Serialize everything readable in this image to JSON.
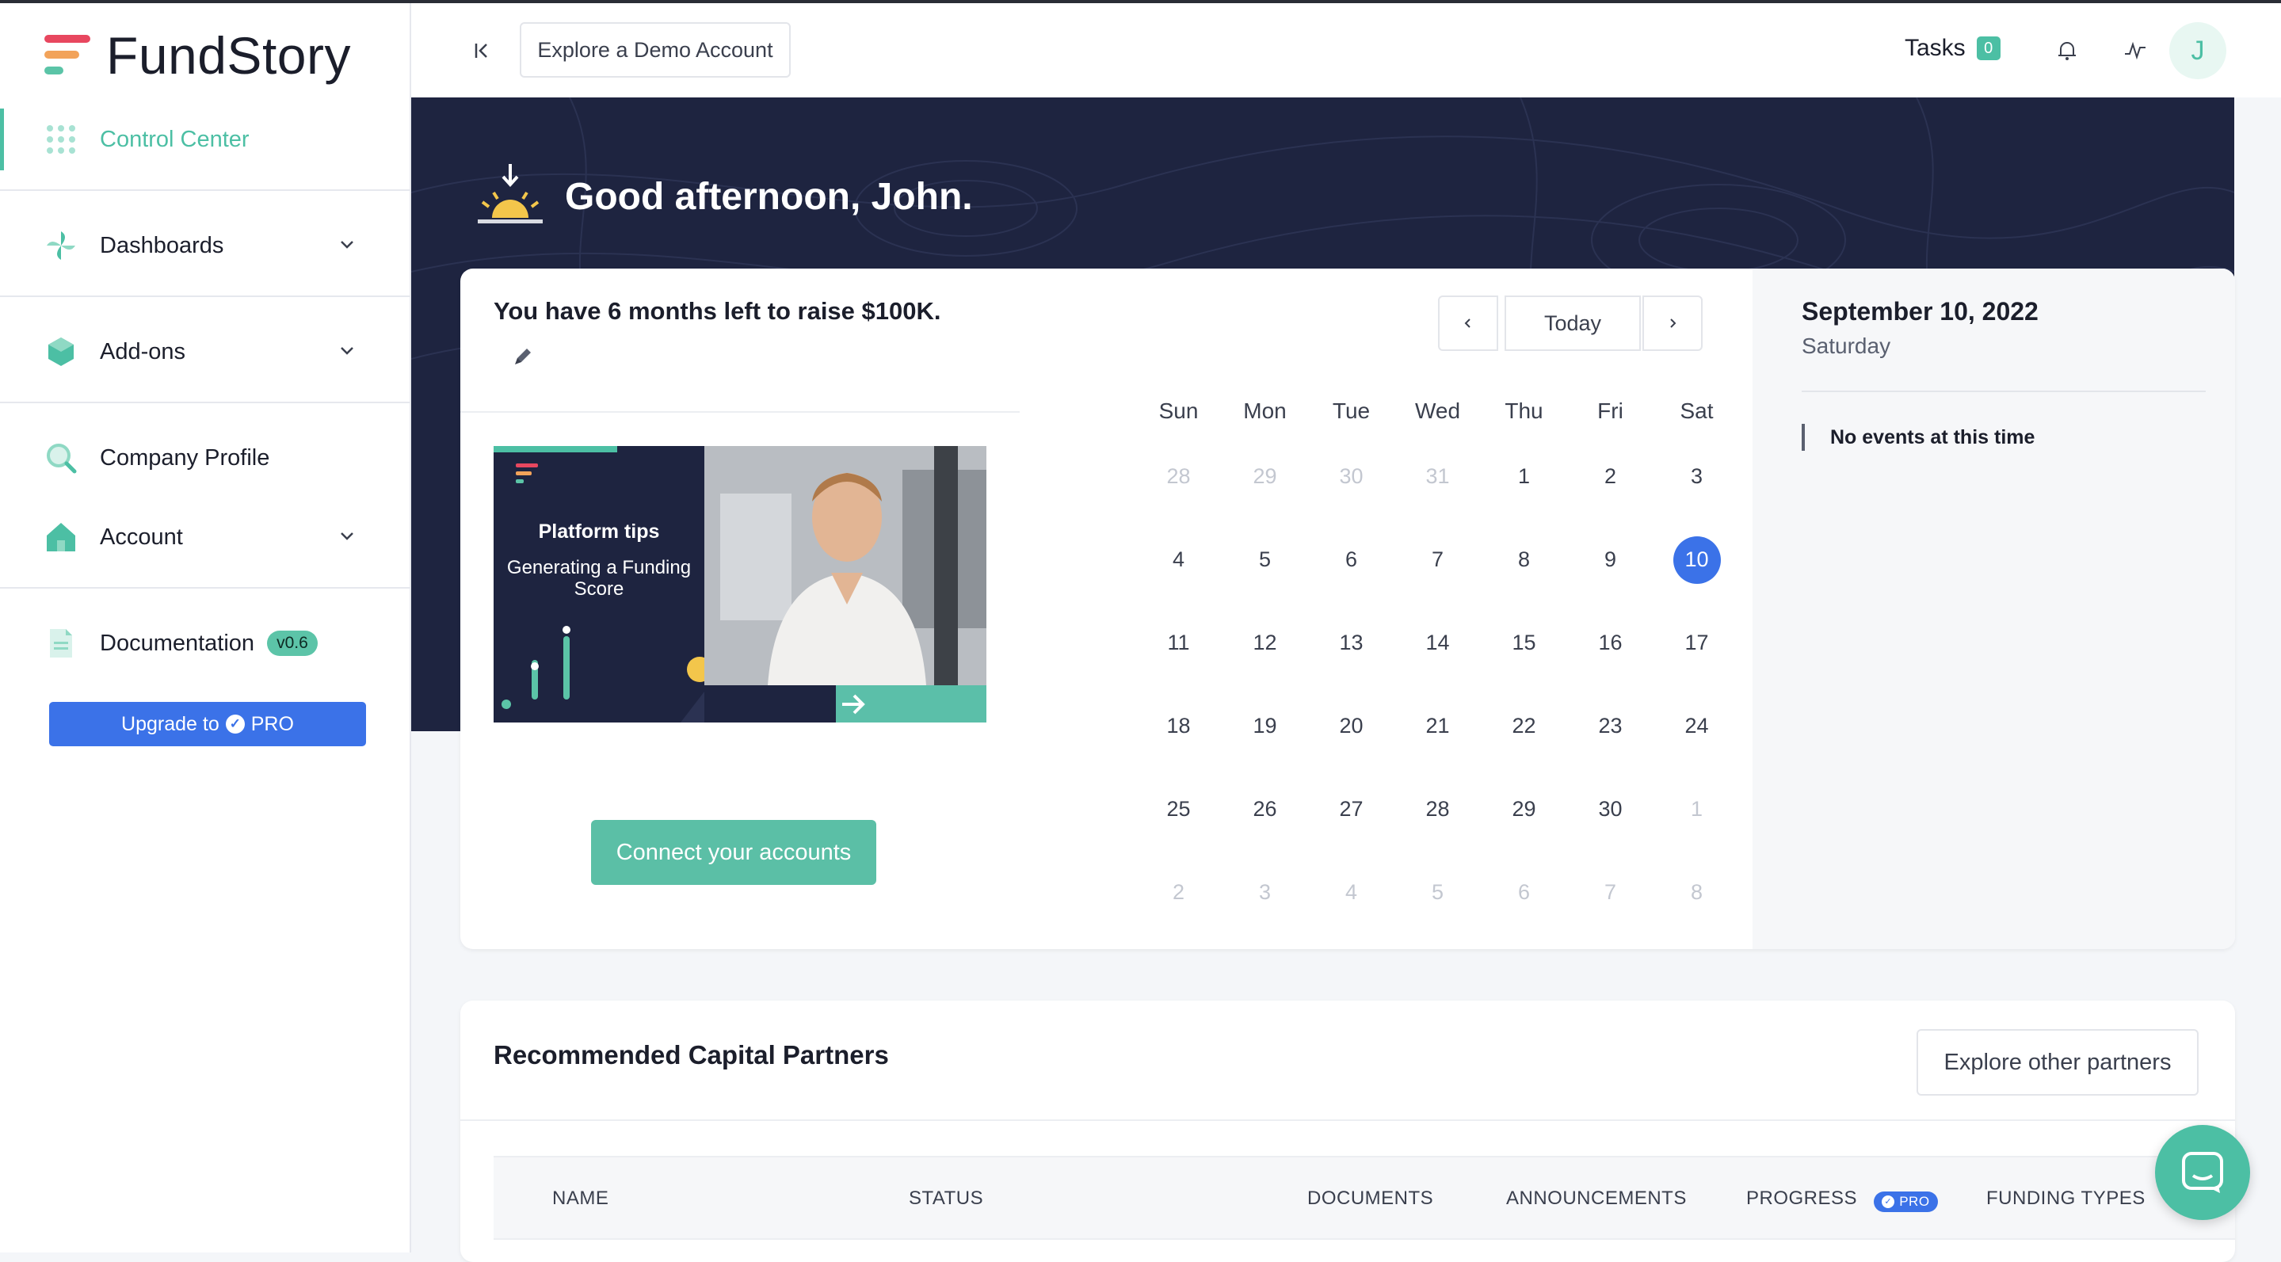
{
  "app": {
    "name": "FundStory"
  },
  "sidebar": {
    "items": [
      {
        "label": "Control Center",
        "icon": "grid-dots-icon",
        "active": true
      },
      {
        "label": "Dashboards",
        "icon": "pinwheel-icon",
        "expandable": true
      },
      {
        "label": "Add-ons",
        "icon": "hexagon-icon",
        "expandable": true
      },
      {
        "label": "Company Profile",
        "icon": "search-icon"
      },
      {
        "label": "Account",
        "icon": "house-icon",
        "expandable": true
      },
      {
        "label": "Documentation",
        "icon": "document-icon",
        "badge": "v0.6"
      }
    ],
    "upgrade": {
      "prefix": "Upgrade to",
      "suffix": "PRO"
    }
  },
  "topbar": {
    "demo_label": "Explore a Demo Account",
    "tasks_label": "Tasks",
    "tasks_count": "0",
    "avatar_initial": "J"
  },
  "hero": {
    "greeting": "Good afternoon, John."
  },
  "card": {
    "raise_text": "You have 6 months left to raise $100K.",
    "video": {
      "title": "Platform tips",
      "subtitle": "Generating a Funding Score"
    },
    "connect_label": "Connect your accounts"
  },
  "calendar": {
    "today_label": "Today",
    "weekdays": [
      "Sun",
      "Mon",
      "Tue",
      "Wed",
      "Thu",
      "Fri",
      "Sat"
    ],
    "weeks": [
      [
        [
          "28",
          1
        ],
        [
          "29",
          1
        ],
        [
          "30",
          1
        ],
        [
          "31",
          1
        ],
        [
          "1",
          0
        ],
        [
          "2",
          0
        ],
        [
          "3",
          0
        ]
      ],
      [
        [
          "4",
          0
        ],
        [
          "5",
          0
        ],
        [
          "6",
          0
        ],
        [
          "7",
          0
        ],
        [
          "8",
          0
        ],
        [
          "9",
          0
        ],
        [
          "10",
          2
        ]
      ],
      [
        [
          "11",
          0
        ],
        [
          "12",
          0
        ],
        [
          "13",
          0
        ],
        [
          "14",
          0
        ],
        [
          "15",
          0
        ],
        [
          "16",
          0
        ],
        [
          "17",
          0
        ]
      ],
      [
        [
          "18",
          0
        ],
        [
          "19",
          0
        ],
        [
          "20",
          0
        ],
        [
          "21",
          0
        ],
        [
          "22",
          0
        ],
        [
          "23",
          0
        ],
        [
          "24",
          0
        ]
      ],
      [
        [
          "25",
          0
        ],
        [
          "26",
          0
        ],
        [
          "27",
          0
        ],
        [
          "28",
          0
        ],
        [
          "29",
          0
        ],
        [
          "30",
          0
        ],
        [
          "1",
          1
        ]
      ],
      [
        [
          "2",
          1
        ],
        [
          "3",
          1
        ],
        [
          "4",
          1
        ],
        [
          "5",
          1
        ],
        [
          "6",
          1
        ],
        [
          "7",
          1
        ],
        [
          "8",
          1
        ]
      ]
    ],
    "selected_date": "September 10, 2022",
    "selected_weekday": "Saturday",
    "no_events": "No events at this time"
  },
  "partners": {
    "title": "Recommended Capital Partners",
    "explore_label": "Explore other partners",
    "columns": [
      "NAME",
      "STATUS",
      "DOCUMENTS",
      "ANNOUNCEMENTS",
      "PROGRESS",
      "FUNDING TYPES"
    ],
    "pro_badge": "PRO"
  },
  "colors": {
    "accent": "#4cbfa4",
    "primary": "#3b72e8",
    "hero_bg": "#1e2440"
  }
}
